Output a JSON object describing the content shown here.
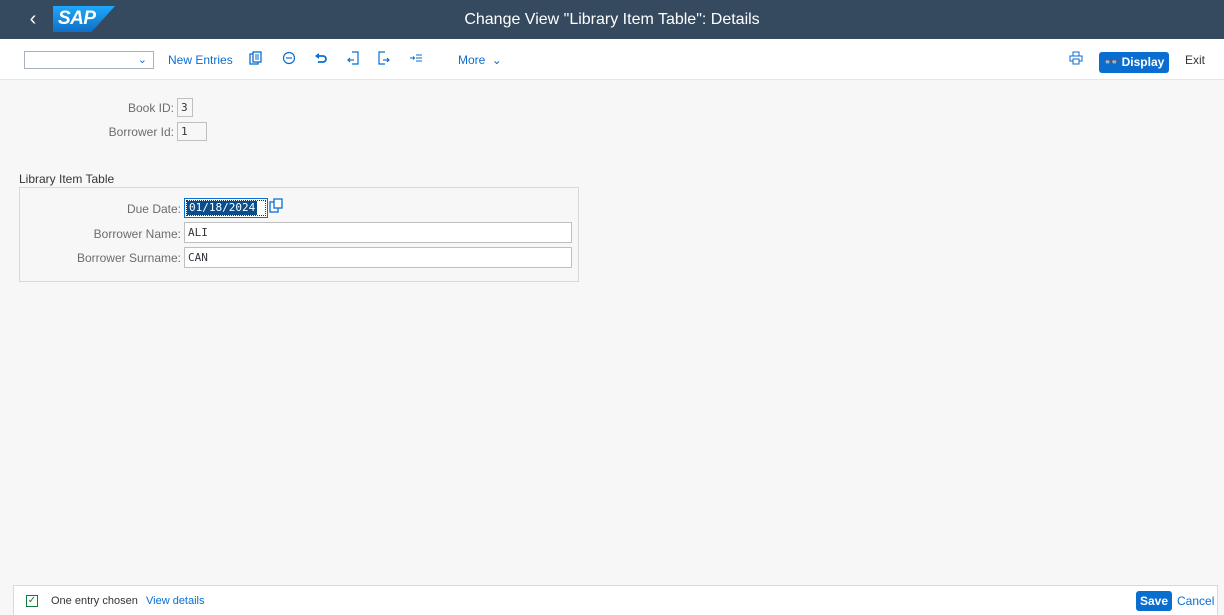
{
  "header": {
    "back_icon": "chevron-left-icon",
    "logo_text": "SAP",
    "title": "Change View \"Library Item Table\": Details"
  },
  "toolbar": {
    "command_field_value": "",
    "new_entries_label": "New Entries",
    "icons": [
      "copy-icon",
      "delete-icon",
      "undo-icon",
      "previous-entry-icon",
      "next-entry-icon",
      "select-all-icon"
    ],
    "more_label": "More",
    "print_icon": "print-icon",
    "display_label": "Display",
    "exit_label": "Exit"
  },
  "form": {
    "book_id_label": "Book ID:",
    "book_id_value": "3",
    "borrower_id_label": "Borrower Id:",
    "borrower_id_value": "1"
  },
  "section": {
    "title": "Library Item Table",
    "due_date_label": "Due Date:",
    "due_date_value": "01/18/2024",
    "borrower_name_label": "Borrower Name:",
    "borrower_name_value": "ALI",
    "borrower_surname_label": "Borrower Surname:",
    "borrower_surname_value": "CAN"
  },
  "footer": {
    "status_message": "One entry chosen",
    "view_details_label": "View details",
    "save_label": "Save",
    "cancel_label": "Cancel"
  },
  "colors": {
    "header_bg": "#354a5f",
    "accent": "#0a6ed1",
    "selection": "#0a4d8c"
  }
}
